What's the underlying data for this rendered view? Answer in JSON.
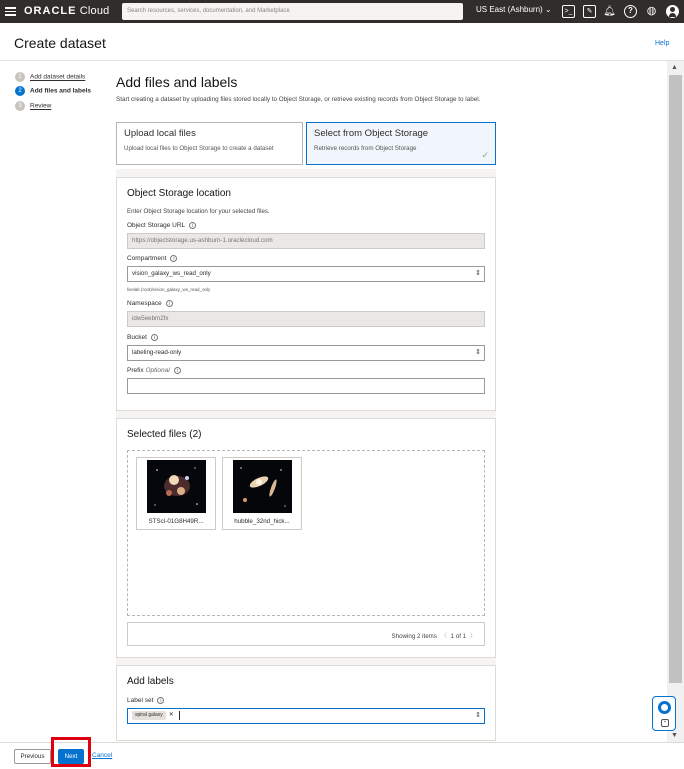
{
  "header": {
    "brand_prefix": "ORACLE",
    "brand_suffix": "Cloud",
    "search_placeholder": "Search resources, services, documentation, and Marketplace",
    "region": "US East (Ashburn)",
    "icons": [
      "menu-icon",
      "cloud-shell-icon",
      "edit-icon",
      "bell-icon",
      "help-icon",
      "globe-icon",
      "user-avatar-icon"
    ]
  },
  "page": {
    "title": "Create dataset",
    "help_link": "Help"
  },
  "steps": [
    {
      "num": "1",
      "label": "Add dataset details",
      "state": "done"
    },
    {
      "num": "2",
      "label": "Add files and labels",
      "state": "active"
    },
    {
      "num": "3",
      "label": "Review",
      "state": "pending"
    }
  ],
  "main": {
    "title": "Add files and labels",
    "intro": "Start creating a dataset by uploading files stored locally to Object Storage, or retrieve existing records from Object Storage to label.",
    "tiles": [
      {
        "title": "Upload local files",
        "desc": "Upload local files to Object Storage to create a dataset",
        "selected": false
      },
      {
        "title": "Select from Object Storage",
        "desc": "Retrieve records from Object Storage",
        "selected": true
      }
    ]
  },
  "os_location": {
    "title": "Object Storage location",
    "subtitle": "Enter Object Storage location for your selected files.",
    "url_label": "Object Storage URL",
    "url_value": "https://objectstorage.us-ashburn-1.oraclecloud.com",
    "compartment_label": "Compartment",
    "compartment_value": "vision_galaxy_ws_read_only",
    "compartment_hint": "livelab (root)/vision_galaxy_ws_read_only",
    "namespace_label": "Namespace",
    "namespace_value": "idw5eebm2fx",
    "bucket_label": "Bucket",
    "bucket_value": "labeling-read-only",
    "prefix_label": "Prefix",
    "prefix_optional": "Optional",
    "prefix_value": ""
  },
  "selected_files": {
    "title": "Selected files (2)",
    "files": [
      {
        "name": "STScI-01G8H49R..."
      },
      {
        "name": "hubble_32nd_hick..."
      }
    ],
    "showing": "Showing 2 items",
    "page": "1 of 1"
  },
  "labels": {
    "title": "Add labels",
    "label_set_label": "Label set",
    "chips": [
      "spiral galaxy"
    ]
  },
  "footer": {
    "previous": "Previous",
    "next": "Next",
    "cancel": "Cancel"
  }
}
